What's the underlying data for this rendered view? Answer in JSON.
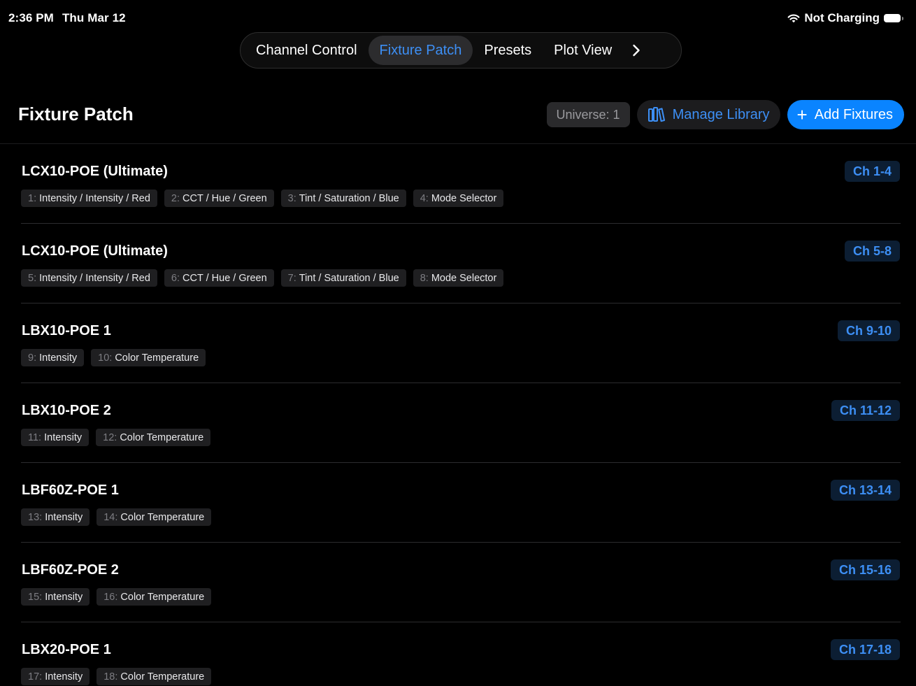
{
  "status_bar": {
    "time": "2:36 PM",
    "date": "Thu Mar 12",
    "charging": "Not Charging",
    "icons": [
      "wifi-icon",
      "battery-icon"
    ]
  },
  "tabs": [
    {
      "label": "Channel Control",
      "active": false
    },
    {
      "label": "Fixture Patch",
      "active": true
    },
    {
      "label": "Presets",
      "active": false
    },
    {
      "label": "Plot View",
      "active": false
    }
  ],
  "header": {
    "title": "Fixture Patch",
    "universe": "Universe: 1",
    "manage_label": "Manage Library",
    "add_label": "Add Fixtures"
  },
  "colors": {
    "accent": "#0a84ff",
    "accent_text": "#3d8ff5",
    "background": "#000000"
  },
  "fixtures": [
    {
      "name": "LCX10-POE (Ultimate)",
      "channels": "Ch 1-4",
      "params": [
        {
          "num": "1:",
          "label": "Intensity / Intensity / Red"
        },
        {
          "num": "2:",
          "label": "CCT / Hue / Green"
        },
        {
          "num": "3:",
          "label": "Tint / Saturation / Blue"
        },
        {
          "num": "4:",
          "label": "Mode Selector"
        }
      ]
    },
    {
      "name": "LCX10-POE (Ultimate)",
      "channels": "Ch 5-8",
      "params": [
        {
          "num": "5:",
          "label": "Intensity / Intensity / Red"
        },
        {
          "num": "6:",
          "label": "CCT / Hue / Green"
        },
        {
          "num": "7:",
          "label": "Tint / Saturation / Blue"
        },
        {
          "num": "8:",
          "label": "Mode Selector"
        }
      ]
    },
    {
      "name": "LBX10-POE 1",
      "channels": "Ch 9-10",
      "params": [
        {
          "num": "9:",
          "label": "Intensity"
        },
        {
          "num": "10:",
          "label": "Color Temperature"
        }
      ]
    },
    {
      "name": "LBX10-POE 2",
      "channels": "Ch 11-12",
      "params": [
        {
          "num": "11:",
          "label": "Intensity"
        },
        {
          "num": "12:",
          "label": "Color Temperature"
        }
      ]
    },
    {
      "name": "LBF60Z-POE 1",
      "channels": "Ch 13-14",
      "params": [
        {
          "num": "13:",
          "label": "Intensity"
        },
        {
          "num": "14:",
          "label": "Color Temperature"
        }
      ]
    },
    {
      "name": "LBF60Z-POE 2",
      "channels": "Ch 15-16",
      "params": [
        {
          "num": "15:",
          "label": "Intensity"
        },
        {
          "num": "16:",
          "label": "Color Temperature"
        }
      ]
    },
    {
      "name": "LBX20-POE 1",
      "channels": "Ch 17-18",
      "params": [
        {
          "num": "17:",
          "label": "Intensity"
        },
        {
          "num": "18:",
          "label": "Color Temperature"
        }
      ]
    }
  ]
}
